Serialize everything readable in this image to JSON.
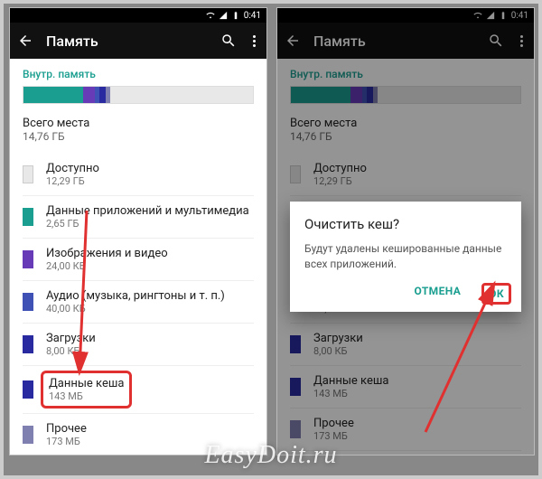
{
  "status": {
    "time": "0:41"
  },
  "appbar": {
    "title": "Память"
  },
  "section_label": "Внутр. память",
  "total": {
    "label": "Всего места",
    "value": "14,76 ГБ"
  },
  "storage_bar": [
    {
      "color": "#1a9e8f",
      "pct": 26
    },
    {
      "color": "#673ab7",
      "pct": 5
    },
    {
      "color": "#3f51b5",
      "pct": 2
    },
    {
      "color": "#2a2aa0",
      "pct": 3
    },
    {
      "color": "#8080b0",
      "pct": 2
    }
  ],
  "rows": [
    {
      "swatch": "#e8e8e8",
      "title": "Доступно",
      "sub": "12,29 ГБ"
    },
    {
      "swatch": "#1a9e8f",
      "title": "Данные приложений и мультимедиа",
      "sub": "2,65 ГБ"
    },
    {
      "swatch": "#673ab7",
      "title": "Изображения и видео",
      "sub": "24,00 КБ"
    },
    {
      "swatch": "#3f51b5",
      "title": "Аудио (музыка, рингтоны и т. п.)",
      "sub": "40,00 КБ"
    },
    {
      "swatch": "#2a2aa0",
      "title": "Загрузки",
      "sub": "8,00 КБ"
    },
    {
      "swatch": "#2a2aa0",
      "title": "Данные кеша",
      "sub": "143 МБ",
      "highlight": true
    },
    {
      "swatch": "#8080b0",
      "title": "Прочее",
      "sub": "173 МБ"
    }
  ],
  "dialog": {
    "title": "Очистить кеш?",
    "body": "Будут удалены кешированные данные всех приложений.",
    "cancel": "ОТМЕНА",
    "ok": "ОК"
  },
  "watermark": "EasyDoit.ru"
}
